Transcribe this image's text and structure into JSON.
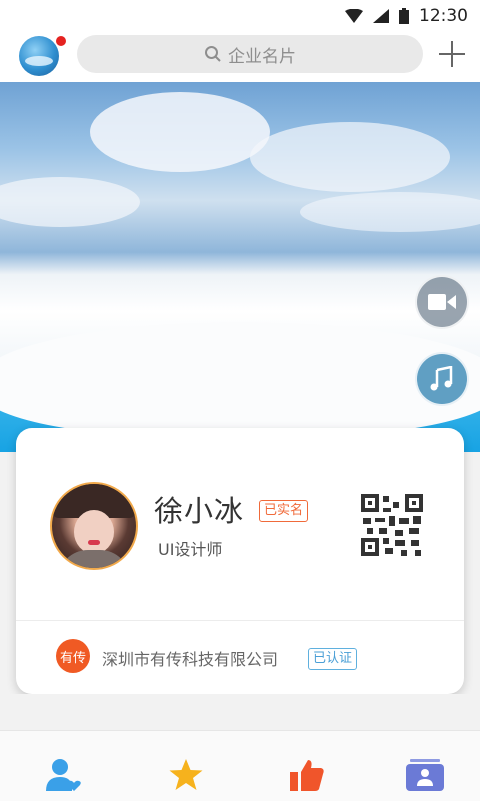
{
  "status_bar": {
    "time": "12:30"
  },
  "header": {
    "search_placeholder": "企业名片",
    "has_notification": true
  },
  "banner": {
    "slide_count": 6,
    "active_slide": 1,
    "side_buttons": [
      "video-icon",
      "music-icon"
    ]
  },
  "card": {
    "name": "徐小冰",
    "name_badge": "已实名",
    "job_title": "UI设计师",
    "company_logo_text": "有传",
    "company_name": "深圳市有传科技有限公司",
    "company_badge": "已认证"
  },
  "bottom_nav": {
    "items": [
      "contacts-icon",
      "star-icon",
      "thumbs-up-icon",
      "card-icon"
    ]
  },
  "colors": {
    "accent_orange": "#f06a3a",
    "accent_blue": "#4a9fd6",
    "notification_red": "#e52220",
    "nav_blue": "#3aa0e8",
    "nav_yellow": "#f6b21d",
    "nav_red": "#f0552b",
    "nav_purple": "#6b7ad6"
  }
}
